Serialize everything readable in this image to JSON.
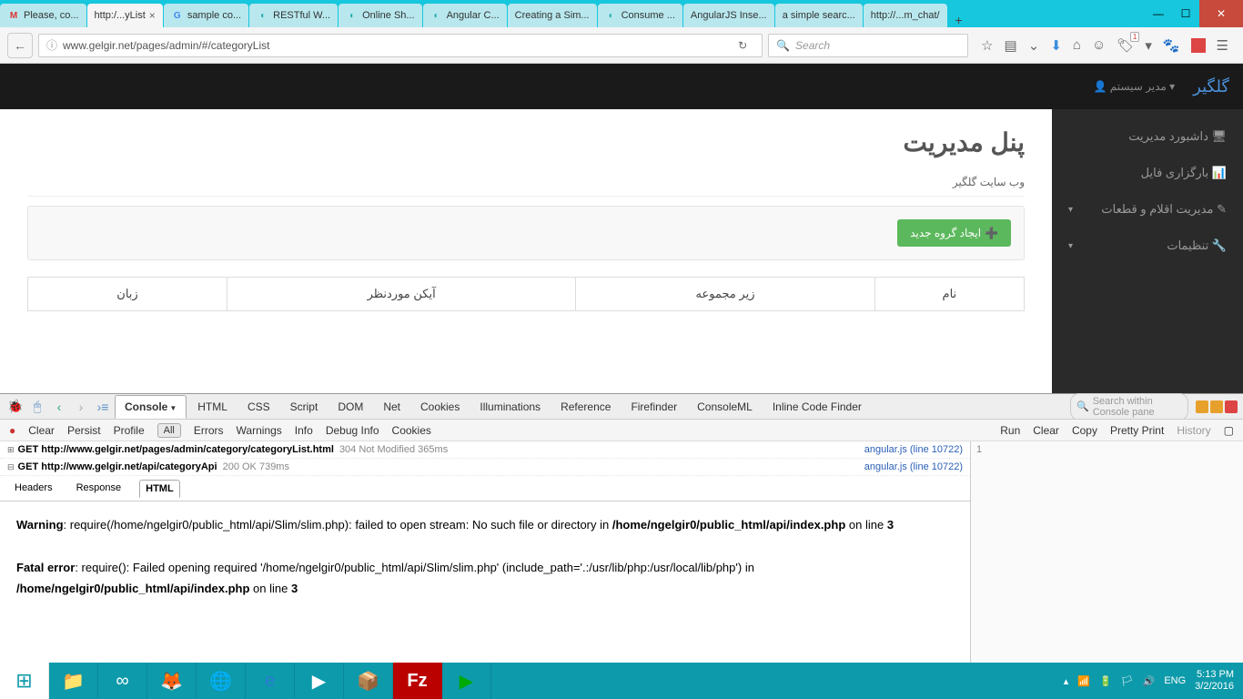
{
  "window": {
    "tabs": [
      {
        "label": "Please, co...",
        "icon": "M"
      },
      {
        "label": "http:/...yList",
        "icon": "",
        "active": true
      },
      {
        "label": "sample co...",
        "icon": "G"
      },
      {
        "label": "RESTful W...",
        "icon": "C"
      },
      {
        "label": "Online Sh...",
        "icon": "C"
      },
      {
        "label": "Angular C...",
        "icon": "C"
      },
      {
        "label": "Creating a Sim...",
        "icon": ""
      },
      {
        "label": "Consume ...",
        "icon": "C"
      },
      {
        "label": "AngularJS Inse...",
        "icon": ""
      },
      {
        "label": "a simple searc...",
        "icon": ""
      },
      {
        "label": "http://...m_chat/",
        "icon": ""
      }
    ]
  },
  "urlbar": {
    "url": "www.gelgir.net/pages/admin/#/categoryList",
    "search_placeholder": "Search",
    "pocket_badge": "1"
  },
  "admin": {
    "brand": "گلگیر",
    "user_label": "مدیر سیستم",
    "sidebar": {
      "dashboard": "داشبورد مدیریت",
      "upload": "بارگزاری فایل",
      "items": "مدیریت اقلام و قطعات",
      "settings": "تنظیمات"
    },
    "title": "پنل مدیریت",
    "breadcrumb": "وب سایت گلگیر",
    "new_group_btn": "ایجاد گروه جدید",
    "table": {
      "col_name": "نام",
      "col_subset": "زیر مجموعه",
      "col_icon": "آیکن موردنظر",
      "col_lang": "زبان"
    }
  },
  "devtools": {
    "tabs": {
      "console": "Console",
      "html": "HTML",
      "css": "CSS",
      "script": "Script",
      "dom": "DOM",
      "net": "Net",
      "cookies": "Cookies",
      "illum": "Illuminations",
      "ref": "Reference",
      "firefinder": "Firefinder",
      "consoleml": "ConsoleML",
      "inline": "Inline Code Finder"
    },
    "search_placeholder": "Search within Console pane",
    "sub": {
      "clear": "Clear",
      "persist": "Persist",
      "profile": "Profile",
      "all": "All",
      "errors": "Errors",
      "warnings": "Warnings",
      "info": "Info",
      "debug": "Debug Info",
      "cookies": "Cookies",
      "run": "Run",
      "clear2": "Clear",
      "copy": "Copy",
      "pretty": "Pretty Print",
      "history": "History"
    },
    "log1": {
      "method": "GET",
      "url": "http://www.gelgir.net/pages/admin/category/categoryList.html",
      "status": "304 Not Modified",
      "time": "365ms",
      "src": "angular.js (line 10722)"
    },
    "log2": {
      "method": "GET",
      "url": "http://www.gelgir.net/api/categoryApi",
      "status": "200 OK",
      "time": "739ms",
      "src": "angular.js (line 10722)"
    },
    "subtabs": {
      "headers": "Headers",
      "response": "Response",
      "html": "HTML"
    },
    "err": {
      "warn_label": "Warning",
      "warn_text": ": require(/home/ngelgir0/public_html/api/Slim/slim.php): failed to open stream: No such file or directory in ",
      "warn_path": "/home/ngelgir0/public_html/api/index.php",
      "online": " on line ",
      "line1": "3",
      "fatal_label": "Fatal error",
      "fatal_text": ": require(): Failed opening required '/home/ngelgir0/public_html/api/Slim/slim.php' (include_path='.:/usr/lib/php:/usr/local/lib/php') in ",
      "fatal_path": "/home/ngelgir0/public_html/api/index.php",
      "line2": "3"
    },
    "side_num": "1"
  },
  "tray": {
    "lang": "ENG",
    "time": "5:13 PM",
    "date": "3/2/2016"
  }
}
